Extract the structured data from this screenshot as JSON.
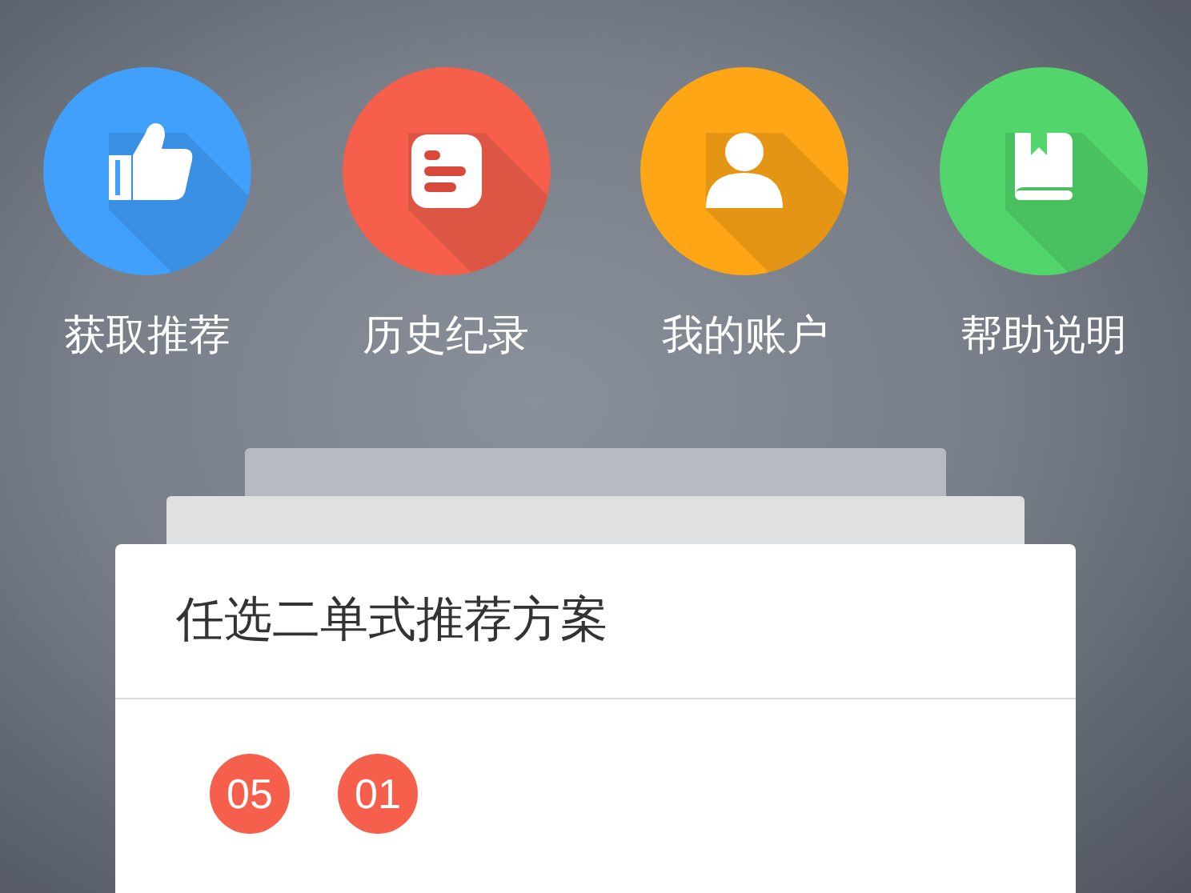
{
  "menu": [
    {
      "kind": "thumb",
      "label": "获取推荐",
      "color": "#40a0fb"
    },
    {
      "kind": "list",
      "label": "历史纪录",
      "color": "#f65f4b"
    },
    {
      "kind": "person",
      "label": "我的账户",
      "color": "#fea616"
    },
    {
      "kind": "book",
      "label": "帮助说明",
      "color": "#52d66b"
    }
  ],
  "card": {
    "title": "任选二单式推荐方案",
    "balls": [
      "05",
      "01"
    ]
  }
}
